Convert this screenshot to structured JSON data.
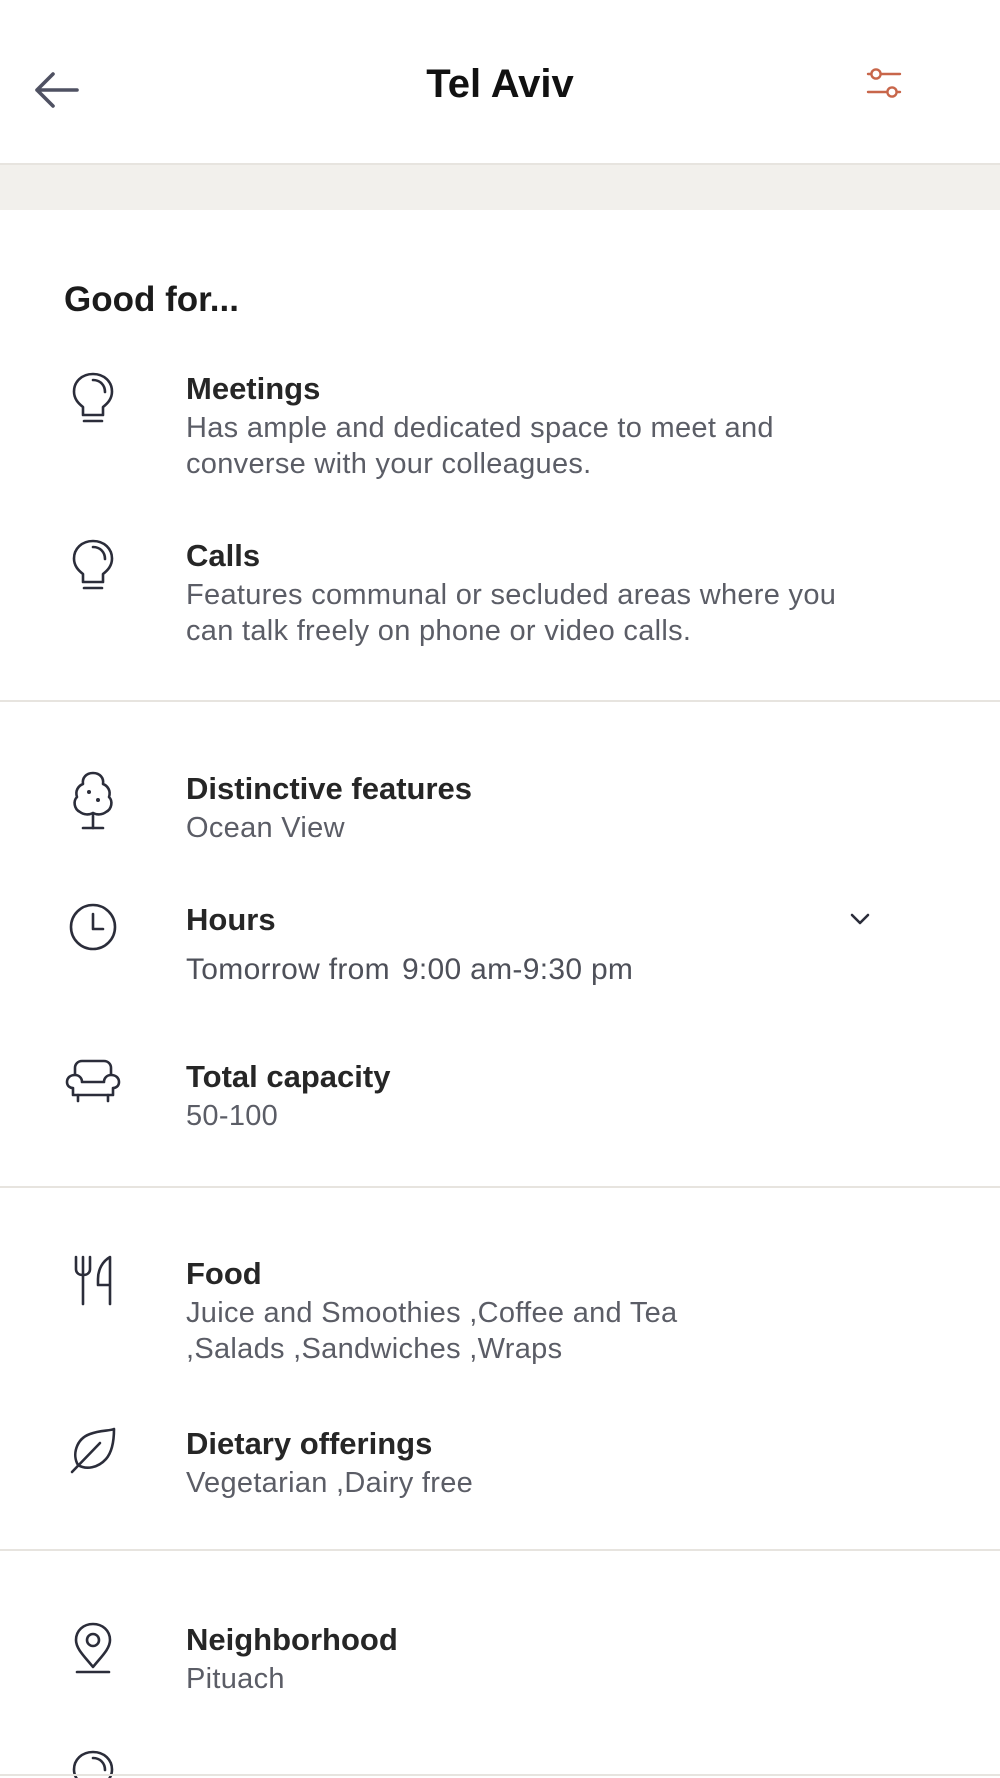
{
  "header": {
    "title": "Tel Aviv",
    "back_icon": "arrow-left-icon",
    "filter_icon": "sliders-icon"
  },
  "colors": {
    "accent": "#c8664a",
    "band": "#f2f0ec",
    "divider": "#e7e4df",
    "text_primary": "#222222",
    "text_secondary": "#5b5d66"
  },
  "good_for": {
    "title": "Good for...",
    "items": [
      {
        "icon": "lightbulb-icon",
        "label": "Meetings",
        "description": "Has ample and dedicated space to meet and converse with your colleagues."
      },
      {
        "icon": "lightbulb-icon",
        "label": "Calls",
        "description": "Features communal or secluded areas where you can talk freely on phone or video calls."
      }
    ]
  },
  "details": {
    "features": {
      "icon": "tree-icon",
      "label": "Distinctive features",
      "value": "Ocean View"
    },
    "hours": {
      "icon": "clock-icon",
      "label": "Hours",
      "prefix": "Tomorrow from",
      "value": "9:00 am-9:30 pm",
      "expand_icon": "chevron-down-icon"
    },
    "capacity": {
      "icon": "armchair-icon",
      "label": "Total capacity",
      "value": "50-100"
    }
  },
  "food": {
    "food": {
      "icon": "fork-knife-icon",
      "label": "Food",
      "value": "Juice and Smoothies ,Coffee and Tea ,Salads ,Sandwiches ,Wraps"
    },
    "dietary": {
      "icon": "leaf-icon",
      "label": "Dietary offerings",
      "value": "Vegetarian ,Dairy free"
    }
  },
  "location": {
    "neighborhood": {
      "icon": "map-pin-icon",
      "label": "Neighborhood",
      "value": "Pituach"
    },
    "next_icon": "lightbulb-icon"
  }
}
